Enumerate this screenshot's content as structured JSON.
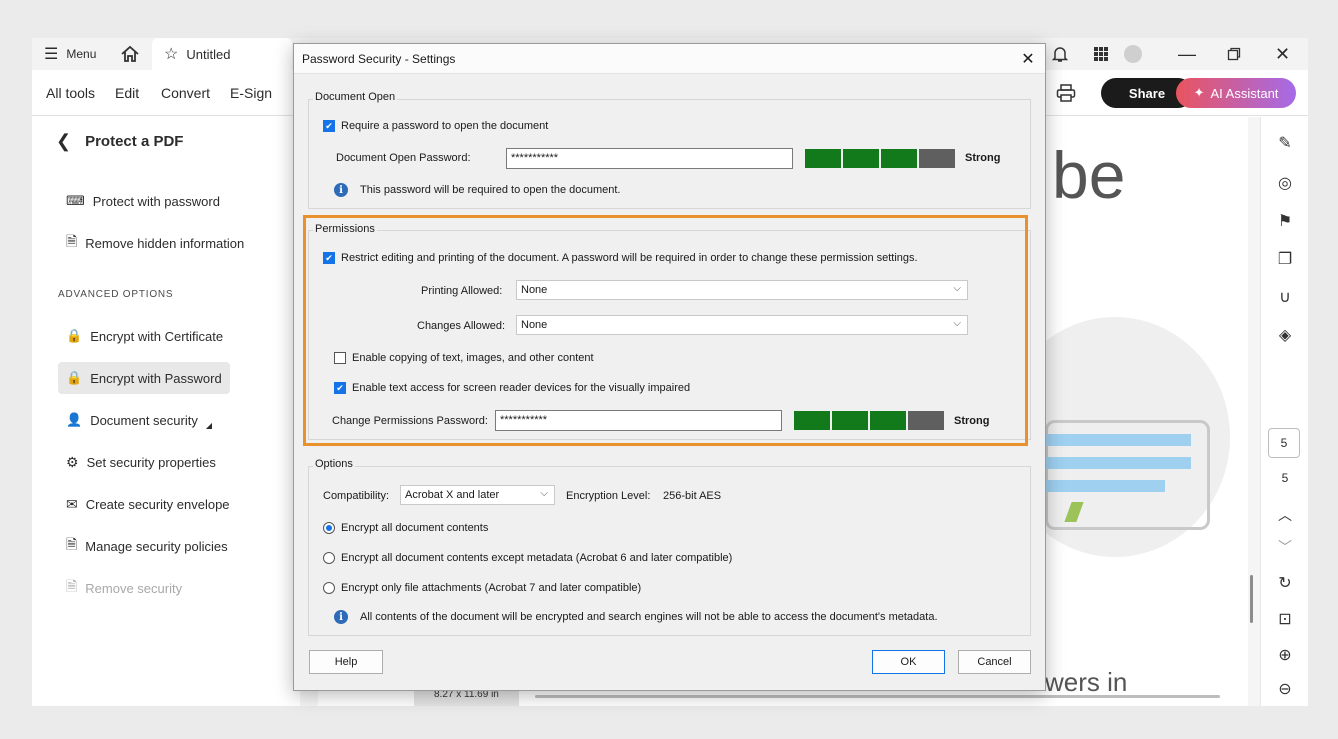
{
  "titlebar": {
    "menu_label": "Menu",
    "tab_title": "Untitled"
  },
  "toolbar": {
    "links": [
      "All tools",
      "Edit",
      "Convert",
      "E-Sign"
    ],
    "share_label": "Share",
    "ai_label": "AI Assistant"
  },
  "leftpanel": {
    "title": "Protect a PDF",
    "items_top": [
      "Protect with password",
      "Remove hidden information"
    ],
    "advanced_heading": "ADVANCED OPTIONS",
    "items_advanced": [
      "Encrypt with Certificate",
      "Encrypt with Password",
      "Document security",
      "Set security properties",
      "Create security envelope",
      "Manage security policies",
      "Remove security"
    ]
  },
  "document": {
    "logo_fragment": "be",
    "bottom_text": "wers in",
    "page_size": "8.27 x 11.69 in"
  },
  "rail": {
    "page_current": "5",
    "page_total": "5"
  },
  "dialog": {
    "title": "Password Security - Settings",
    "doc_open": {
      "label": "Document Open",
      "require_label": "Require a password to open the document",
      "require_checked": true,
      "password_label": "Document Open Password:",
      "password_value": "***********",
      "strength_label": "Strong",
      "info": "This password will be required to open the document."
    },
    "permissions": {
      "label": "Permissions",
      "restrict_label": "Restrict editing and printing of the document. A password will be required in order to change these permission settings.",
      "restrict_checked": true,
      "printing_label": "Printing Allowed:",
      "printing_value": "None",
      "changes_label": "Changes Allowed:",
      "changes_value": "None",
      "copy_label": "Enable copying of text, images, and other content",
      "copy_checked": false,
      "screenreader_label": "Enable text access for screen reader devices for the visually impaired",
      "screenreader_checked": true,
      "password_label": "Change Permissions Password:",
      "password_value": "***********",
      "strength_label": "Strong"
    },
    "options": {
      "label": "Options",
      "compat_label": "Compatibility:",
      "compat_value": "Acrobat X and later",
      "enc_label": "Encryption  Level:",
      "enc_value": "256-bit AES",
      "radio_all": "Encrypt all document contents",
      "radio_except": "Encrypt all document contents except metadata (Acrobat 6 and later compatible)",
      "radio_attach": "Encrypt only file attachments (Acrobat 7 and later compatible)",
      "info": "All contents of the document will be encrypted and search engines will not be able to access the document's metadata."
    },
    "help_label": "Help",
    "ok_label": "OK",
    "cancel_label": "Cancel"
  },
  "colors": {
    "strong_green": "#137a1c",
    "weak_gray": "#5f5f5f",
    "accent_blue": "#1473e6",
    "highlight_orange": "#e8912d",
    "ai_red": "#e9545f"
  }
}
